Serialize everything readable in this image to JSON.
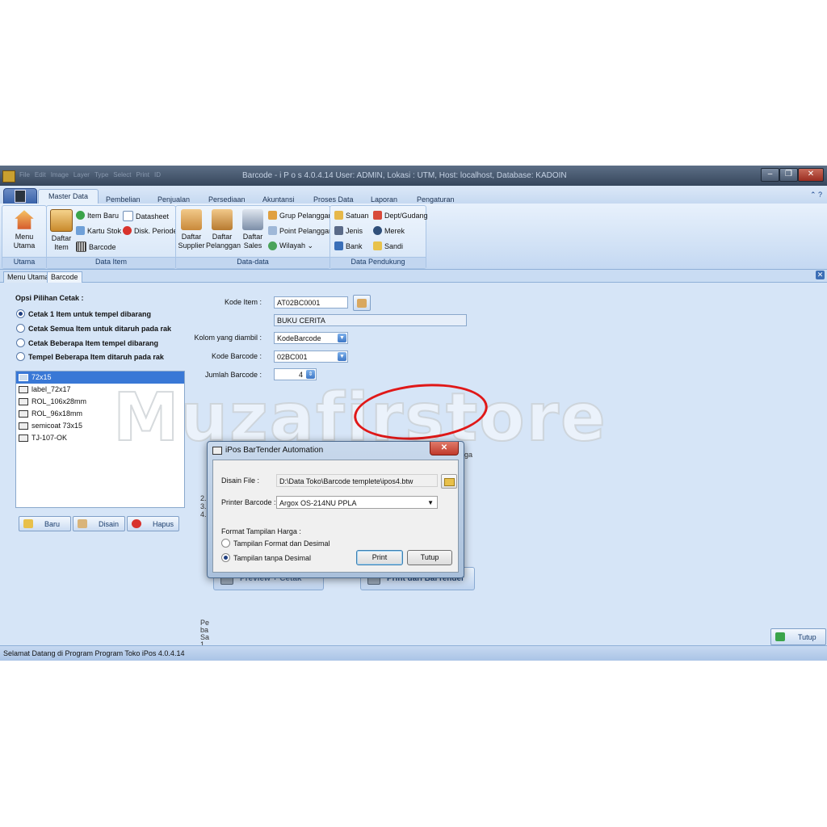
{
  "window": {
    "title": "Barcode - i P o s 4.0.4.14 User: ADMIN, Lokasi : UTM, Host: localhost, Database: KADOIN",
    "quick_access": [
      "File",
      "Edit",
      "Image",
      "Layer",
      "Type",
      "Select",
      "Print",
      "ID"
    ],
    "controls": {
      "minimize": "–",
      "restore": "❐",
      "close": "✕"
    }
  },
  "ribbon": {
    "tabs": [
      "Master Data",
      "Pembelian",
      "Penjualan",
      "Persediaan",
      "Akuntansi",
      "Proses Data",
      "Laporan",
      "Pengaturan"
    ],
    "active_tab": "Master Data",
    "helper": "⌃ ?",
    "groups": {
      "utama": {
        "label": "Utama",
        "menu_utama": "Menu Utama"
      },
      "data_item": {
        "label": "Data Item",
        "daftar": "Daftar",
        "item": "Item",
        "item_baru": "Item Baru",
        "kartu_stok": "Kartu Stok",
        "barcode": "Barcode",
        "datasheet": "Datasheet",
        "disk_periode": "Disk. Periode"
      },
      "data_data": {
        "label": "Data-data",
        "supplier_1": "Daftar",
        "supplier_2": "Supplier",
        "pelanggan_1": "Daftar",
        "pelanggan_2": "Pelanggan",
        "sales_1": "Daftar",
        "sales_2": "Sales",
        "grup_pelanggan": "Grup Pelanggan",
        "point_pelanggan": "Point Pelanggan",
        "wilayah": "Wilayah ⌄"
      },
      "data_pendukung": {
        "label": "Data Pendukung",
        "satuan": "Satuan",
        "jenis": "Jenis",
        "bank": "Bank",
        "dept_gudang": "Dept/Gudang",
        "merek": "Merek",
        "sandi": "Sandi"
      }
    }
  },
  "doc_tabs": [
    "Menu Utama",
    "Barcode"
  ],
  "doc_close": "✕",
  "form": {
    "opsi_title": "Opsi Pilihan Cetak :",
    "options": [
      "Cetak 1 Item untuk tempel dibarang",
      "Cetak Semua Item untuk ditaruh pada rak",
      "Cetak Beberapa Item tempel dibarang",
      "Tempel Beberapa Item ditaruh pada rak"
    ],
    "selected_option": 0,
    "templates": [
      "72x15",
      "label_72x17",
      "ROL_106x28mm",
      "ROL_96x18mm",
      "semicoat 73x15",
      "TJ-107-OK"
    ],
    "selected_template": 0,
    "btn_baru": "Baru",
    "btn_disain": "Disain",
    "btn_hapus": "Hapus",
    "kode_item_label": "Kode Item :",
    "kode_item": "AT02BC0001",
    "nama_item": "BUKU CERITA",
    "kolom_label": "Kolom yang diambil :",
    "kolom": "KodeBarcode",
    "kode_barcode_label": "Kode Barcode :",
    "kode_barcode": "02BC001",
    "jumlah_label": "Jumlah Barcode :",
    "jumlah": "4",
    "btn_preview": "Preview + Cetak",
    "btn_bartender": "Print dari BarTender",
    "btn_tutup": "Tutup",
    "obscured_fragments": [
      "Pe",
      "ba",
      "Sa",
      "1.",
      "2.",
      "3.",
      "4.",
      "ga"
    ]
  },
  "dialog": {
    "title": "iPos BarTender Automation",
    "close": "✕",
    "disain_label": "Disain File :",
    "disain_file": "D:\\Data Toko\\Barcode templete\\ipos4.btw",
    "printer_label": "Printer Barcode :",
    "printer": "Argox OS-214NU PPLA",
    "format_label": "Format Tampilan Harga :",
    "format_options": [
      "Tampilan Format dan Desimal",
      "Tampilan tanpa Desimal"
    ],
    "selected_format": 1,
    "btn_print": "Print",
    "btn_tutup": "Tutup"
  },
  "status": "Selamat Datang di Program Program Toko iPos 4.0.4.14",
  "watermark": "Muzafirstore",
  "colors": {
    "accent": "#3978d6",
    "annotation": "#e01818",
    "ribbon": "#cfe0f5"
  }
}
